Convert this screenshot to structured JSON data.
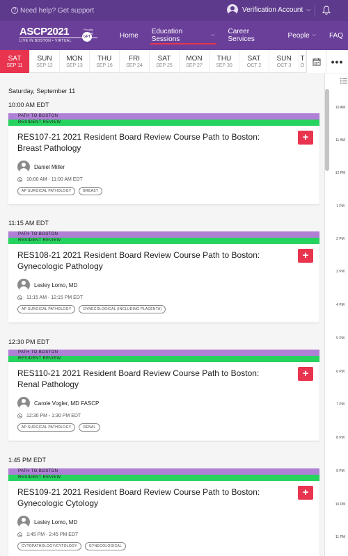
{
  "topbar": {
    "help_text": "Need help? Get support",
    "account_label": "Verification Account"
  },
  "logo": {
    "name": "ASCP2021",
    "tagline": "LIVE IN BOSTON • VIRTUAL",
    "host_text": "Proudly Hosting",
    "badge": "GPT"
  },
  "nav": {
    "items": [
      {
        "label": "Home"
      },
      {
        "label": "Education Sessions",
        "active": true,
        "dropdown": true
      },
      {
        "label": "Career Services"
      },
      {
        "label": "People",
        "dropdown": true
      },
      {
        "label": "FAQ"
      }
    ]
  },
  "days": [
    {
      "day": "SAT",
      "date": "SEP 11",
      "active": true
    },
    {
      "day": "SUN",
      "date": "SEP 12"
    },
    {
      "day": "MON",
      "date": "SEP 13"
    },
    {
      "day": "THU",
      "date": "SEP 16"
    },
    {
      "day": "FRI",
      "date": "SEP 24"
    },
    {
      "day": "SAT",
      "date": "SEP 25"
    },
    {
      "day": "MON",
      "date": "SEP 27"
    },
    {
      "day": "THU",
      "date": "SEP 30"
    },
    {
      "day": "SAT",
      "date": "OCT 2"
    },
    {
      "day": "SUN",
      "date": "OCT 3"
    },
    {
      "day": "T",
      "date": "O"
    }
  ],
  "list": {
    "date_heading": "Saturday, September 11",
    "track_primary": "PATH TO BOSTON",
    "track_secondary": "RESIDENT REVIEW",
    "add_label": "+",
    "sessions": [
      {
        "slot_time": "10:00 AM EDT",
        "title": "RES107-21 2021 Resident Board Review Course Path to Boston: Breast Pathology",
        "speaker": "Daniel Miller",
        "time_range": "10:00 AM - 11:00 AM EDT",
        "tags": [
          "AP SURGICAL PATHOLOGY",
          "BREAST"
        ]
      },
      {
        "slot_time": "11:15 AM EDT",
        "title": "RES108-21 2021 Resident Board Review Course Path to Boston: Gynecologic Pathology",
        "speaker": "Lesley Lomo, MD",
        "time_range": "11:15 AM - 12:15 PM EDT",
        "tags": [
          "AP SURGICAL PATHOLOGY",
          "GYNECOLOGICAL (INCLUDING PLACENTA)"
        ]
      },
      {
        "slot_time": "12:30 PM EDT",
        "title": "RES110-21 2021 Resident Board Review Course Path to Boston: Renal Pathology",
        "speaker": "Carole Vogler, MD FASCP",
        "time_range": "12:30 PM - 1:30 PM EDT",
        "tags": [
          "AP SURGICAL PATHOLOGY",
          "RENAL"
        ]
      },
      {
        "slot_time": "1:45 PM EDT",
        "title": "RES109-21 2021 Resident Board Review Course Path to Boston: Gynecologic Cytology",
        "speaker": "Lesley Lomo, MD",
        "time_range": "1:45 PM - 2:45 PM EDT",
        "tags": [
          "CYTOPATHOLOGY/CYTOLOGY",
          "GYNECOLOGICAL"
        ]
      }
    ]
  },
  "timeline": {
    "ticks": [
      "10 AM",
      "11 AM",
      "12 PM",
      "1 PM",
      "2 PM",
      "3 PM",
      "4 PM",
      "5 PM",
      "6 PM",
      "7 PM",
      "8 PM",
      "9 PM",
      "10 PM",
      "11 PM"
    ]
  },
  "colors": {
    "topbar": "#5d3a8c",
    "nav": "#6a3f99",
    "accent_red": "#e8344e",
    "track_purple": "#b07fd6",
    "track_green": "#27d35f"
  },
  "icons": {
    "help": "help-circle-icon",
    "account": "user-avatar-icon",
    "notifications": "bell-icon",
    "calendar": "calendar-icon",
    "more": "more-horizontal-icon",
    "list_view": "list-view-icon",
    "clock": "clock-icon"
  }
}
